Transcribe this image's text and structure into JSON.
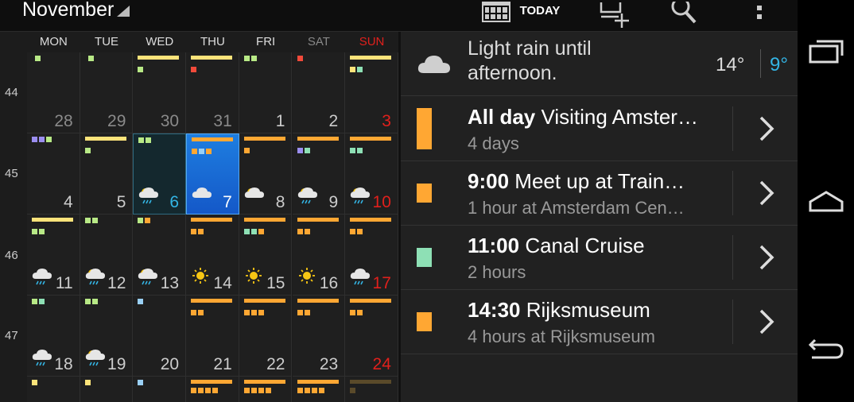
{
  "header": {
    "month": "November",
    "today_label": "TODAY"
  },
  "calendar": {
    "days_of_week": [
      "MON",
      "TUE",
      "WED",
      "THU",
      "FRI",
      "SAT",
      "SUN"
    ],
    "week_numbers": [
      "44",
      "45",
      "46",
      "47"
    ],
    "weeks": [
      [
        "28",
        "29",
        "30",
        "31",
        "1",
        "2",
        "3"
      ],
      [
        "4",
        "5",
        "6",
        "7",
        "8",
        "9",
        "10"
      ],
      [
        "11",
        "12",
        "13",
        "14",
        "15",
        "16",
        "17"
      ],
      [
        "18",
        "19",
        "20",
        "21",
        "22",
        "23",
        "24"
      ]
    ],
    "selected_day": "7",
    "today_day": "6"
  },
  "weather": {
    "summary": "Light rain until afternoon.",
    "high": "14°",
    "low": "9°"
  },
  "agenda": [
    {
      "time": "All day",
      "title": "Visiting Amster…",
      "detail": "4 days",
      "color": "#ffa733"
    },
    {
      "time": "9:00",
      "title": "Meet up at Train…",
      "detail": "1 hour at Amsterdam Cen…",
      "color": "#ffa733"
    },
    {
      "time": "11:00",
      "title": "Canal Cruise",
      "detail": "2 hours",
      "color": "#8ee0b5"
    },
    {
      "time": "14:30",
      "title": "Rijksmuseum",
      "detail": "4 hours at Rijksmuseum",
      "color": "#ffa733"
    }
  ],
  "colors": {
    "orange": "#ffa733",
    "yellow": "#fde37a",
    "green": "#b8e986",
    "mint": "#8ee0b5",
    "purple": "#9b8ef0",
    "blue": "#9ad0f5",
    "red": "#f24a3a",
    "accent": "#33b5e5",
    "sunday": "#e0201c"
  }
}
